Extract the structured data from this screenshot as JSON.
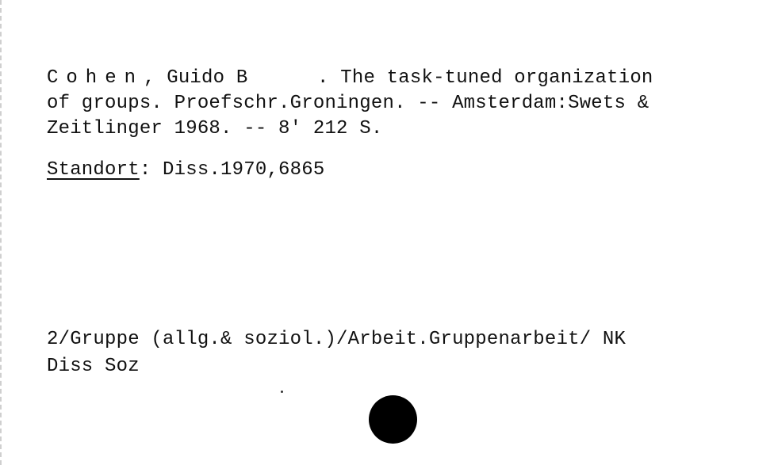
{
  "card": {
    "author_surname": "Cohen",
    "author_given": ", Guido B",
    "title_part": "      . The task-tuned organization",
    "line2": "of groups. Proefschr.Groningen. -- Amsterdam:Swets &",
    "line3": "Zeitlinger 1968. -- 8' 212 S.",
    "location_label": "Standort",
    "location_value": ": Diss.1970,6865",
    "subject_line": "2/Gruppe (allg.& soziol.)/Arbeit.Gruppenarbeit/ NK",
    "class_line": "Diss Soz"
  }
}
